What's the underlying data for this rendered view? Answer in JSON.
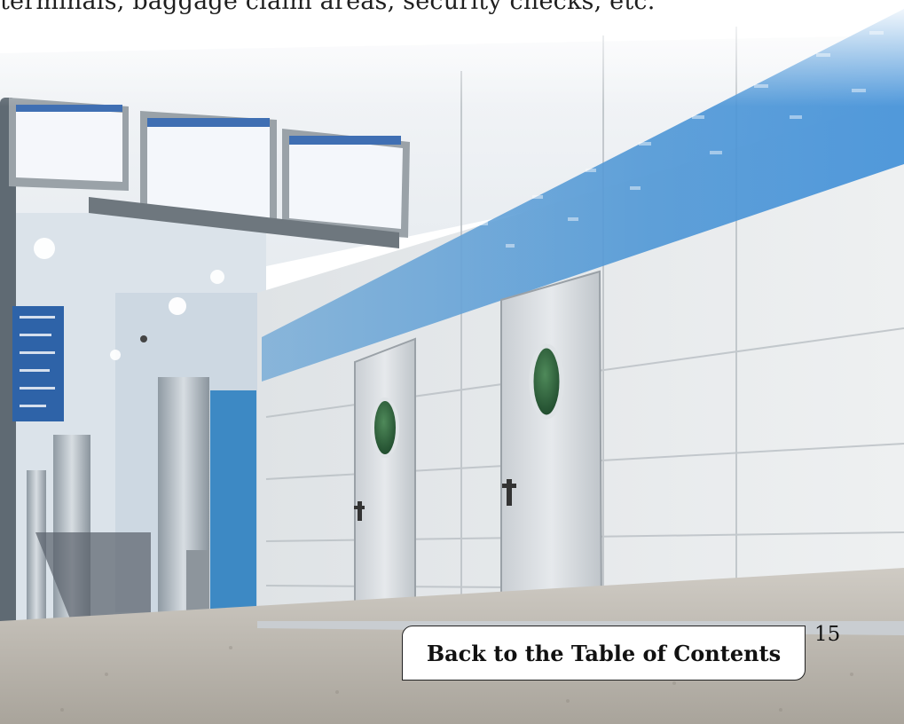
{
  "intro": {
    "text": "terminals, baggage claim areas, security checks, etc."
  },
  "photo": {
    "subject": "airport corridor with departure monitors and steel doors"
  },
  "navigation": {
    "toc_label": "Back to the Table of Contents"
  },
  "footer": {
    "page_number": "15"
  }
}
